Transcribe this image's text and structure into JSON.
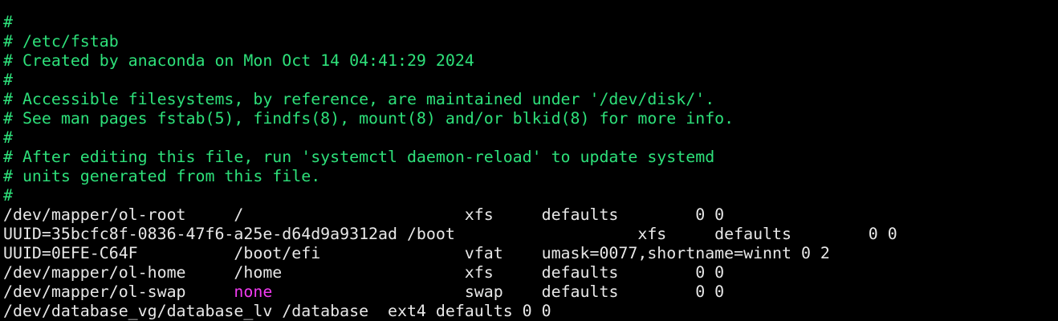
{
  "colors": {
    "background": "#000000",
    "comment": "#2EE07A",
    "text": "#E8E8E8",
    "highlight_none": "#F23BF2"
  },
  "comments": [
    "#",
    "# /etc/fstab",
    "# Created by anaconda on Mon Oct 14 04:41:29 2024",
    "#",
    "# Accessible filesystems, by reference, are maintained under '/dev/disk/'.",
    "# See man pages fstab(5), findfs(8), mount(8) and/or blkid(8) for more info.",
    "#",
    "# After editing this file, run 'systemctl daemon-reload' to update systemd",
    "# units generated from this file.",
    "#"
  ],
  "entries": [
    {
      "device": "/dev/mapper/ol-root",
      "mount": "/",
      "type": "xfs",
      "options": "defaults",
      "dump_pass": "0 0",
      "raw": "/dev/mapper/ol-root     /                       xfs     defaults        0 0"
    },
    {
      "device": "UUID=35bcfc8f-0836-47f6-a25e-d64d9a9312ad",
      "mount": "/boot",
      "type": "xfs",
      "options": "defaults",
      "dump_pass": "0 0",
      "raw": "UUID=35bcfc8f-0836-47f6-a25e-d64d9a9312ad /boot                   xfs     defaults        0 0"
    },
    {
      "device": "UUID=0EFE-C64F",
      "mount": "/boot/efi",
      "type": "vfat",
      "options": "umask=0077,shortname=winnt",
      "dump_pass": "0 2",
      "raw": "UUID=0EFE-C64F          /boot/efi               vfat    umask=0077,shortname=winnt 0 2"
    },
    {
      "device": "/dev/mapper/ol-home",
      "mount": "/home",
      "type": "xfs",
      "options": "defaults",
      "dump_pass": "0 0",
      "raw": "/dev/mapper/ol-home     /home                   xfs     defaults        0 0"
    },
    {
      "device": "/dev/mapper/ol-swap",
      "mount": "none",
      "type": "swap",
      "options": "defaults",
      "dump_pass": "0 0",
      "raw_before": "/dev/mapper/ol-swap     ",
      "raw_highlight": "none",
      "raw_after": "                    swap    defaults        0 0"
    },
    {
      "device": "/dev/database_vg/database_lv",
      "mount": "/database",
      "type": "ext4",
      "options": "defaults",
      "dump_pass": "0 0",
      "raw": "/dev/database_vg/database_lv /database  ext4 defaults 0 0"
    }
  ]
}
